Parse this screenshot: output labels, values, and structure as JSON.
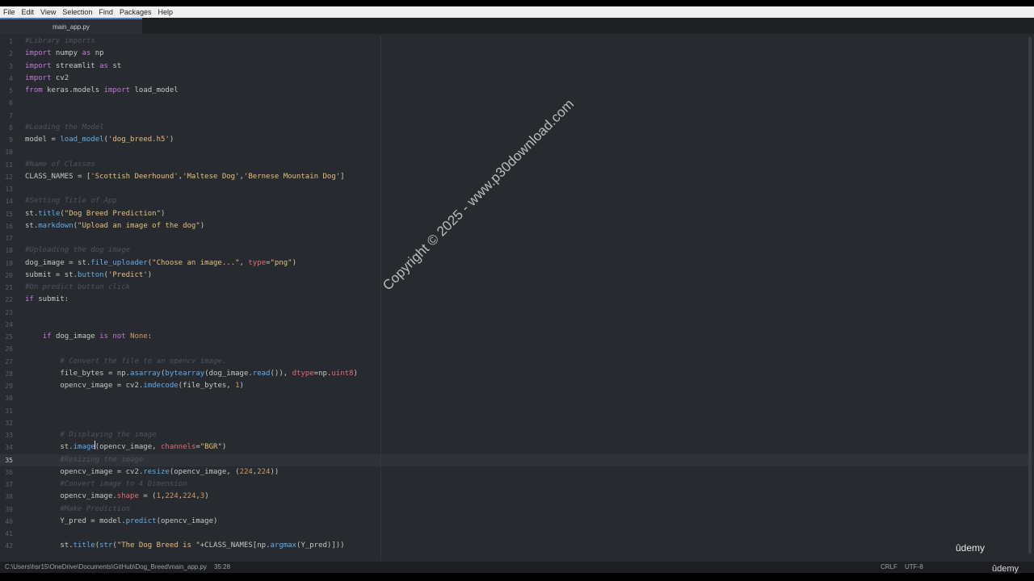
{
  "menu": [
    "File",
    "Edit",
    "View",
    "Selection",
    "Find",
    "Packages",
    "Help"
  ],
  "tab": {
    "title": "main_app.py"
  },
  "code": {
    "cursor_line": 35,
    "lines": [
      {
        "n": "1",
        "parts": [
          {
            "t": "#Library imports",
            "c": "cm"
          }
        ]
      },
      {
        "n": "2",
        "parts": [
          {
            "t": "import",
            "c": "kw"
          },
          {
            "t": " numpy ",
            "c": ""
          },
          {
            "t": "as",
            "c": "kw"
          },
          {
            "t": " np",
            "c": ""
          }
        ]
      },
      {
        "n": "3",
        "parts": [
          {
            "t": "import",
            "c": "kw"
          },
          {
            "t": " streamlit ",
            "c": ""
          },
          {
            "t": "as",
            "c": "kw"
          },
          {
            "t": " st",
            "c": ""
          }
        ]
      },
      {
        "n": "4",
        "parts": [
          {
            "t": "import",
            "c": "kw"
          },
          {
            "t": " cv2",
            "c": ""
          }
        ]
      },
      {
        "n": "5",
        "parts": [
          {
            "t": "from",
            "c": "kw"
          },
          {
            "t": " keras.models ",
            "c": ""
          },
          {
            "t": "import",
            "c": "kw"
          },
          {
            "t": " load_model",
            "c": ""
          }
        ]
      },
      {
        "n": "6",
        "parts": []
      },
      {
        "n": "7",
        "parts": []
      },
      {
        "n": "8",
        "parts": [
          {
            "t": "#Loading the Model",
            "c": "cm"
          }
        ]
      },
      {
        "n": "9",
        "parts": [
          {
            "t": "model = ",
            "c": ""
          },
          {
            "t": "load_model",
            "c": "fn"
          },
          {
            "t": "(",
            "c": ""
          },
          {
            "t": "'dog_breed.h5'",
            "c": "str"
          },
          {
            "t": ")",
            "c": ""
          }
        ]
      },
      {
        "n": "10",
        "parts": []
      },
      {
        "n": "11",
        "parts": [
          {
            "t": "#Name of Classes",
            "c": "cm"
          }
        ]
      },
      {
        "n": "12",
        "parts": [
          {
            "t": "CLASS_NAMES = [",
            "c": ""
          },
          {
            "t": "'Scottish Deerhound'",
            "c": "str"
          },
          {
            "t": ",",
            "c": ""
          },
          {
            "t": "'Maltese Dog'",
            "c": "str"
          },
          {
            "t": ",",
            "c": ""
          },
          {
            "t": "'Bernese Mountain Dog'",
            "c": "str"
          },
          {
            "t": "]",
            "c": ""
          }
        ]
      },
      {
        "n": "13",
        "parts": []
      },
      {
        "n": "14",
        "parts": [
          {
            "t": "#Setting Title of App",
            "c": "cm"
          }
        ]
      },
      {
        "n": "15",
        "parts": [
          {
            "t": "st.",
            "c": ""
          },
          {
            "t": "title",
            "c": "fn"
          },
          {
            "t": "(",
            "c": ""
          },
          {
            "t": "\"Dog Breed Prediction\"",
            "c": "str"
          },
          {
            "t": ")",
            "c": ""
          }
        ]
      },
      {
        "n": "16",
        "parts": [
          {
            "t": "st.",
            "c": ""
          },
          {
            "t": "markdown",
            "c": "fn"
          },
          {
            "t": "(",
            "c": ""
          },
          {
            "t": "\"Upload an image of the dog\"",
            "c": "str"
          },
          {
            "t": ")",
            "c": ""
          }
        ]
      },
      {
        "n": "17",
        "parts": []
      },
      {
        "n": "18",
        "parts": [
          {
            "t": "#Uploading the dog image",
            "c": "cm"
          }
        ]
      },
      {
        "n": "19",
        "parts": [
          {
            "t": "dog_image = st.",
            "c": ""
          },
          {
            "t": "file_uploader",
            "c": "fn"
          },
          {
            "t": "(",
            "c": ""
          },
          {
            "t": "\"Choose an image...\"",
            "c": "str"
          },
          {
            "t": ", ",
            "c": ""
          },
          {
            "t": "type",
            "c": "pr"
          },
          {
            "t": "=",
            "c": ""
          },
          {
            "t": "\"png\"",
            "c": "str"
          },
          {
            "t": ")",
            "c": ""
          }
        ]
      },
      {
        "n": "20",
        "parts": [
          {
            "t": "submit = st.",
            "c": ""
          },
          {
            "t": "button",
            "c": "fn"
          },
          {
            "t": "(",
            "c": ""
          },
          {
            "t": "'Predict'",
            "c": "str"
          },
          {
            "t": ")",
            "c": ""
          }
        ]
      },
      {
        "n": "21",
        "parts": [
          {
            "t": "#On predict button click",
            "c": "cm"
          }
        ]
      },
      {
        "n": "22",
        "parts": [
          {
            "t": "if",
            "c": "kw"
          },
          {
            "t": " submit:",
            "c": ""
          }
        ]
      },
      {
        "n": "23",
        "parts": []
      },
      {
        "n": "24",
        "parts": []
      },
      {
        "n": "25",
        "parts": [
          {
            "t": "    ",
            "c": ""
          },
          {
            "t": "if",
            "c": "kw"
          },
          {
            "t": " dog_image ",
            "c": ""
          },
          {
            "t": "is not",
            "c": "kw"
          },
          {
            "t": " ",
            "c": ""
          },
          {
            "t": "None",
            "c": "num"
          },
          {
            "t": ":",
            "c": ""
          }
        ]
      },
      {
        "n": "26",
        "parts": []
      },
      {
        "n": "27",
        "parts": [
          {
            "t": "        ",
            "c": ""
          },
          {
            "t": "# Convert the file to an opencv image.",
            "c": "cm"
          }
        ]
      },
      {
        "n": "28",
        "parts": [
          {
            "t": "        file_bytes = np.",
            "c": ""
          },
          {
            "t": "asarray",
            "c": "fn"
          },
          {
            "t": "(",
            "c": ""
          },
          {
            "t": "bytearray",
            "c": "fn"
          },
          {
            "t": "(dog_image.",
            "c": ""
          },
          {
            "t": "read",
            "c": "fn"
          },
          {
            "t": "()), ",
            "c": ""
          },
          {
            "t": "dtype",
            "c": "pr"
          },
          {
            "t": "=np.",
            "c": ""
          },
          {
            "t": "uint8",
            "c": "pr"
          },
          {
            "t": ")",
            "c": ""
          }
        ]
      },
      {
        "n": "29",
        "parts": [
          {
            "t": "        opencv_image = cv2.",
            "c": ""
          },
          {
            "t": "imdecode",
            "c": "fn"
          },
          {
            "t": "(file_bytes, ",
            "c": ""
          },
          {
            "t": "1",
            "c": "num"
          },
          {
            "t": ")",
            "c": ""
          }
        ]
      },
      {
        "n": "30",
        "parts": []
      },
      {
        "n": "31",
        "parts": []
      },
      {
        "n": "32",
        "parts": []
      },
      {
        "n": "33",
        "parts": [
          {
            "t": "        ",
            "c": ""
          },
          {
            "t": "# Displaying the image",
            "c": "cm"
          }
        ]
      },
      {
        "n": "34",
        "parts": [
          {
            "t": "        st.",
            "c": ""
          },
          {
            "t": "image",
            "c": "fn"
          },
          {
            "t": "(opencv_image, ",
            "c": ""
          },
          {
            "t": "channels",
            "c": "pr"
          },
          {
            "t": "=",
            "c": ""
          },
          {
            "t": "\"BGR\"",
            "c": "str"
          },
          {
            "t": ")",
            "c": ""
          }
        ]
      },
      {
        "n": "35",
        "parts": [
          {
            "t": "        ",
            "c": ""
          },
          {
            "t": "#Resizing the image",
            "c": "cm"
          }
        ]
      },
      {
        "n": "36",
        "parts": [
          {
            "t": "        opencv_image = cv2.",
            "c": ""
          },
          {
            "t": "resize",
            "c": "fn"
          },
          {
            "t": "(opencv_image, (",
            "c": ""
          },
          {
            "t": "224",
            "c": "num"
          },
          {
            "t": ",",
            "c": ""
          },
          {
            "t": "224",
            "c": "num"
          },
          {
            "t": "))",
            "c": ""
          }
        ]
      },
      {
        "n": "37",
        "parts": [
          {
            "t": "        ",
            "c": ""
          },
          {
            "t": "#Convert image to 4 Dimension",
            "c": "cm"
          }
        ]
      },
      {
        "n": "38",
        "parts": [
          {
            "t": "        opencv_image.",
            "c": ""
          },
          {
            "t": "shape",
            "c": "pr"
          },
          {
            "t": " = (",
            "c": ""
          },
          {
            "t": "1",
            "c": "num"
          },
          {
            "t": ",",
            "c": ""
          },
          {
            "t": "224",
            "c": "num"
          },
          {
            "t": ",",
            "c": ""
          },
          {
            "t": "224",
            "c": "num"
          },
          {
            "t": ",",
            "c": ""
          },
          {
            "t": "3",
            "c": "num"
          },
          {
            "t": ")",
            "c": ""
          }
        ]
      },
      {
        "n": "39",
        "parts": [
          {
            "t": "        ",
            "c": ""
          },
          {
            "t": "#Make Prediction",
            "c": "cm"
          }
        ]
      },
      {
        "n": "40",
        "parts": [
          {
            "t": "        Y_pred = model.",
            "c": ""
          },
          {
            "t": "predict",
            "c": "fn"
          },
          {
            "t": "(opencv_image)",
            "c": ""
          }
        ]
      },
      {
        "n": "41",
        "parts": []
      },
      {
        "n": "42",
        "parts": [
          {
            "t": "        st.",
            "c": ""
          },
          {
            "t": "title",
            "c": "fn"
          },
          {
            "t": "(",
            "c": ""
          },
          {
            "t": "str",
            "c": "fn"
          },
          {
            "t": "(",
            "c": ""
          },
          {
            "t": "\"The Dog Breed is \"",
            "c": "str"
          },
          {
            "t": "+CLASS_NAMES[np.",
            "c": ""
          },
          {
            "t": "argmax",
            "c": "fn"
          },
          {
            "t": "(Y_pred)]))",
            "c": ""
          }
        ]
      }
    ]
  },
  "status": {
    "path": "C:\\Users\\hsr15\\OneDrive\\Documents\\GitHub\\Dog_Breed\\main_app.py",
    "cursor": "35:28",
    "eol": "CRLF",
    "encoding": "UTF-8"
  },
  "watermark": "Copyright © 2025 - www.p30download.com",
  "branding": {
    "logo1": "ûdemy",
    "logo2": "ûdemy"
  },
  "colors": {
    "accent": "#3b7dd8",
    "editor_bg": "#272a2f",
    "keyword": "#c678dd",
    "function": "#61afef",
    "string": "#e5c07b",
    "number": "#d19a66",
    "comment": "#4f545d"
  }
}
